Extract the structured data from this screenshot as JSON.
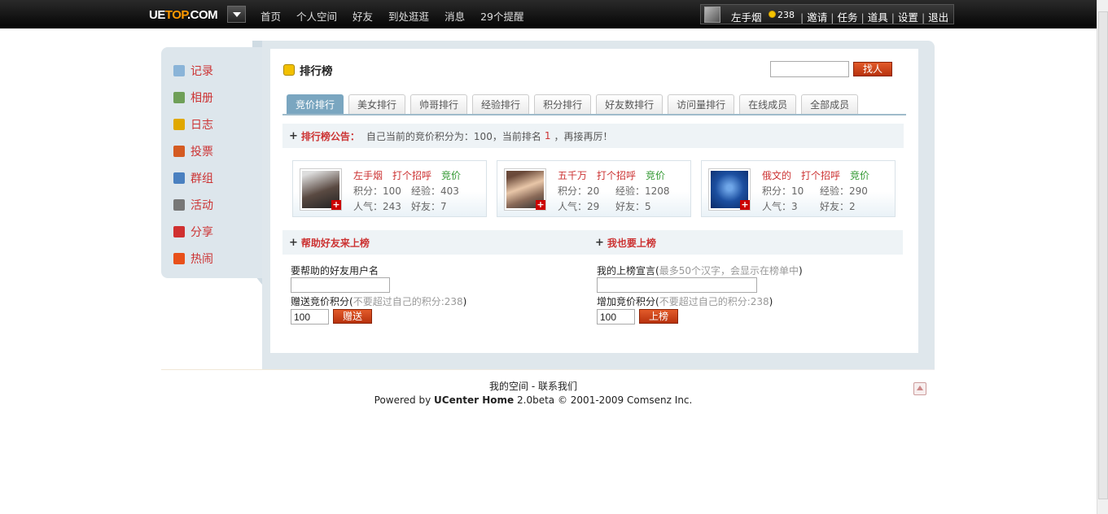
{
  "topbar": {
    "logo_pre": "UE",
    "logo_mid": "TOP",
    "logo_post": ".COM",
    "nav": [
      "首页",
      "个人空间",
      "好友",
      "到处逛逛",
      "消息",
      "29个提醒"
    ],
    "user_name": "左手烟",
    "credits": "238",
    "user_links": [
      "邀请",
      "任务",
      "道具",
      "设置",
      "退出"
    ]
  },
  "sidebar": {
    "items": [
      {
        "label": "记录",
        "icon": "speech-bubble-icon",
        "color": "#8ab4d8"
      },
      {
        "label": "相册",
        "icon": "photo-album-icon",
        "color": "#6f9f58"
      },
      {
        "label": "日志",
        "icon": "notebook-icon",
        "color": "#e0a800"
      },
      {
        "label": "投票",
        "icon": "bar-chart-icon",
        "color": "#d45b22"
      },
      {
        "label": "群组",
        "icon": "group-icon",
        "color": "#4a80c0"
      },
      {
        "label": "活动",
        "icon": "calendar-icon",
        "color": "#777777"
      },
      {
        "label": "分享",
        "icon": "hearts-icon",
        "color": "#d03030"
      },
      {
        "label": "热闹",
        "icon": "flame-icon",
        "color": "#e8501a"
      }
    ]
  },
  "page": {
    "title": "排行榜",
    "search_button": "找人"
  },
  "tabs": [
    "竞价排行",
    "美女排行",
    "帅哥排行",
    "经验排行",
    "积分排行",
    "好友数排行",
    "访问量排行",
    "在线成员",
    "全部成员"
  ],
  "notice": {
    "label": "排行榜公告：",
    "text_before": "自己当前的竞价积分为：100，当前排名",
    "rank": "1",
    "text_after": "，再接再厉！"
  },
  "cards": [
    {
      "name": "左手烟",
      "greet": "打个招呼",
      "bid": "竞价",
      "score": "积分：100",
      "exp": "经验：403",
      "pop": "人气：243",
      "friends": "好友：7",
      "avatar_color": "#5a4a42"
    },
    {
      "name": "五千万",
      "greet": "打个招呼",
      "bid": "竞价",
      "score": "积分：20",
      "exp": "经验：1208",
      "pop": "人气：29",
      "friends": "好友：5",
      "avatar_color": "#8a6a58"
    },
    {
      "name": "俄文的",
      "greet": "打个招呼",
      "bid": "竞价",
      "score": "积分：10",
      "exp": "经验：290",
      "pop": "人气：3",
      "friends": "好友：2",
      "avatar_color": "#1c4fa0"
    }
  ],
  "help": {
    "title": "帮助好友来上榜",
    "username_label": "要帮助的好友用户名",
    "gift_label": "赠送竞价积分(",
    "gift_hint": "不要超过自己的积分:238",
    "gift_close": ")",
    "gift_value": "100",
    "gift_button": "赠送"
  },
  "join": {
    "title": "我也要上榜",
    "motto_label": "我的上榜宣言(",
    "motto_hint": "最多50个汉字，会显示在榜单中",
    "motto_close": ")",
    "add_label": "增加竞价积分(",
    "add_hint": "不要超过自己的积分:238",
    "add_close": ")",
    "add_value": "100",
    "add_button": "上榜"
  },
  "footer": {
    "links": "我的空间 - 联系我们",
    "powered_pre": "Powered by",
    "powered_brand": "UCenter Home",
    "powered_post": "2.0beta © 2001-2009 Comsenz Inc."
  }
}
